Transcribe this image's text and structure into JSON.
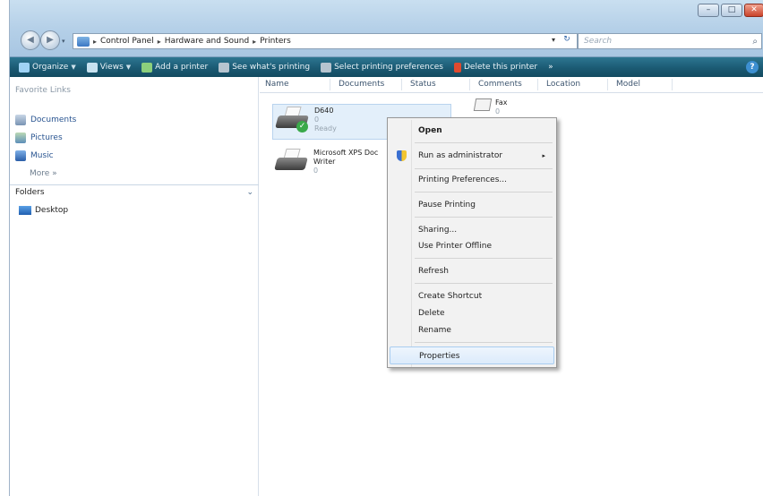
{
  "window": {
    "minimize": "–",
    "maximize": "□",
    "close": "✕"
  },
  "nav": {
    "back": "◀",
    "forward": "▶",
    "recent": "▾"
  },
  "address": {
    "crumbs": [
      "Control Panel",
      "Hardware and Sound",
      "Printers"
    ],
    "separator": "▸",
    "dropdown": "▾",
    "refresh": "↻"
  },
  "search": {
    "placeholder": "Search",
    "icon": "⌕"
  },
  "toolbar": {
    "organize": "Organize",
    "views": "Views",
    "add_printer": "Add a printer",
    "see_printing": "See what's printing",
    "select_prefs": "Select printing preferences",
    "delete_printer": "Delete this printer",
    "more": "»",
    "help": "?"
  },
  "sidebar": {
    "favorites_title": "Favorite Links",
    "favorites": [
      {
        "label": "Documents"
      },
      {
        "label": "Pictures"
      },
      {
        "label": "Music"
      }
    ],
    "more": "More »",
    "folders_label": "Folders",
    "folders_chevron": "⌄",
    "tree": [
      {
        "label": "Desktop"
      }
    ]
  },
  "columns": [
    "Name",
    "Documents",
    "Status",
    "Comments",
    "Location",
    "Model"
  ],
  "printers": [
    {
      "name": "D640",
      "docs": "0",
      "status": "Ready",
      "default": true
    },
    {
      "name": "Microsoft XPS Doc",
      "name2": "Writer",
      "docs": "0"
    }
  ],
  "fax": {
    "name": "Fax",
    "docs": "0"
  },
  "context_menu": {
    "open": "Open",
    "run_as_admin": "Run as administrator",
    "submenu_arrow": "▸",
    "printing_prefs": "Printing Preferences...",
    "pause": "Pause Printing",
    "sharing": "Sharing...",
    "use_offline": "Use Printer Offline",
    "refresh": "Refresh",
    "create_shortcut": "Create Shortcut",
    "delete": "Delete",
    "rename": "Rename",
    "properties": "Properties"
  },
  "colors": {
    "command_bar": "#1b5a73",
    "selection": "#e3effa",
    "menu_hover": "#dcebfb"
  }
}
